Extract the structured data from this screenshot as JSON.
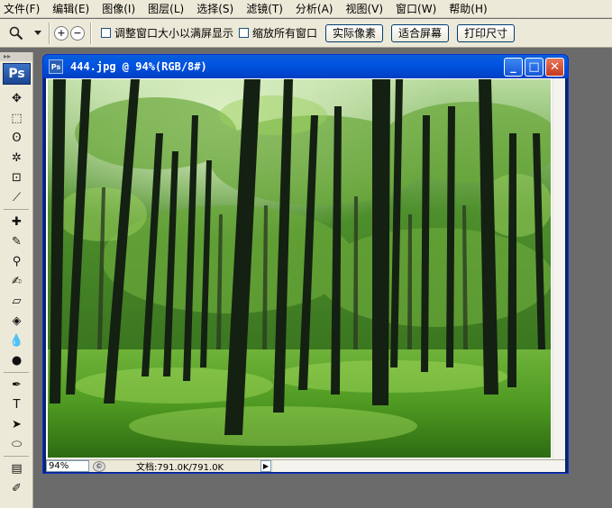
{
  "menu": [
    "文件(F)",
    "编辑(E)",
    "图像(I)",
    "图层(L)",
    "选择(S)",
    "滤镜(T)",
    "分析(A)",
    "视图(V)",
    "窗口(W)",
    "帮助(H)"
  ],
  "options": {
    "zoom_in_glyph": "+",
    "zoom_out_glyph": "−",
    "resize_windows_label": "调整窗口大小以满屏显示",
    "zoom_all_windows_label": "缩放所有窗口",
    "actual_pixels_label": "实际像素",
    "fit_screen_label": "适合屏幕",
    "print_size_label": "打印尺寸"
  },
  "toolbox": {
    "logo": "Ps",
    "grip": "▸▸",
    "tools": [
      "move-tool",
      "marquee-tool",
      "lasso-tool",
      "magic-wand-tool",
      "crop-tool",
      "slice-tool",
      "healing-brush-tool",
      "brush-tool",
      "clone-stamp-tool",
      "history-brush-tool",
      "eraser-tool",
      "paint-bucket-tool",
      "blur-tool",
      "dodge-tool",
      "pen-tool",
      "type-tool",
      "path-selection-tool",
      "shape-tool",
      "notes-tool",
      "eyedropper-tool"
    ],
    "glyphs": [
      "✥",
      "⬚",
      "ʘ",
      "✲",
      "⊡",
      "⟋",
      "✚",
      "✎",
      "⚲",
      "✍",
      "▱",
      "◈",
      "💧",
      "●",
      "✒",
      "T",
      "➤",
      "⬭",
      "▤",
      "✐"
    ]
  },
  "document": {
    "icon": "Ps",
    "title": "444.jpg @ 94%(RGB/8#)",
    "zoom": "94%",
    "doc_size": "文档:791.0K/791.0K",
    "status_icon": "©",
    "status_arrow": "▶"
  },
  "window_buttons": {
    "minimize": "_",
    "maximize": "□",
    "close": "✕"
  },
  "colors": {
    "titlebar": "#0054e3",
    "workspace": "#6b6b6b",
    "chrome": "#ece9d8"
  }
}
